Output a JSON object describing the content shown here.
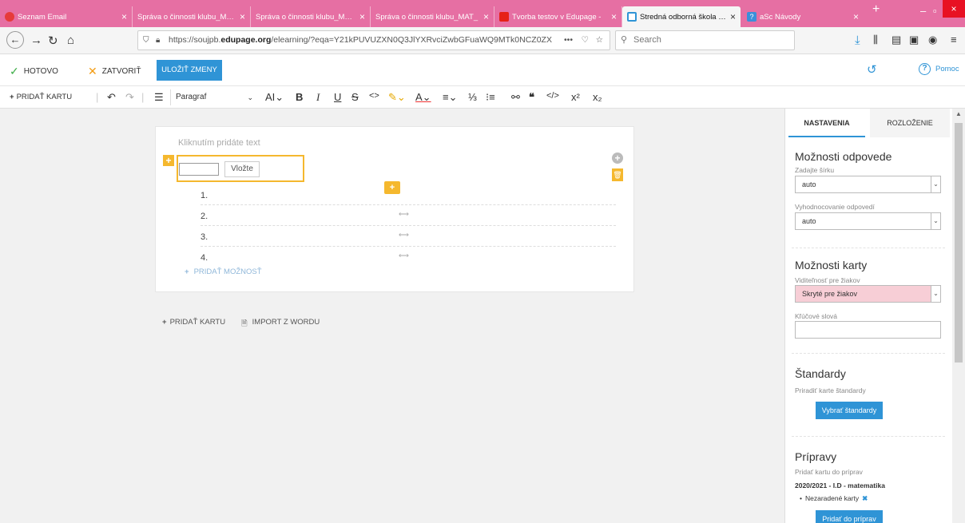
{
  "browser": {
    "tabs": [
      {
        "label": "Seznam Email",
        "icon": "seznam-icon",
        "active": false
      },
      {
        "label": "Správa o činnosti klubu_MAT_",
        "icon": "",
        "active": false
      },
      {
        "label": "Správa o činnosti klubu_MAT_",
        "icon": "",
        "active": false
      },
      {
        "label": "Správa o činnosti klubu_MAT_",
        "icon": "",
        "active": false
      },
      {
        "label": "Tvorba testov v Edupage -",
        "icon": "youtube-icon",
        "active": false
      },
      {
        "label": "Stredná odborná škola stro",
        "icon": "edupage-icon",
        "active": true
      },
      {
        "label": "aSc Návody",
        "icon": "help-icon",
        "active": false
      }
    ],
    "url_prefix": "https://soujpb.",
    "url_domain": "edupage.org",
    "url_rest": "/elearning/?eqa=Y21kPUVUZXN0Q3JlYXRvciZwbGFuaWQ9MTk0NCZ0ZX",
    "search_placeholder": "Search"
  },
  "app_toolbar": {
    "done_label": "HOTOVO",
    "close_label": "ZATVORIŤ",
    "save_label": "ULOŽIŤ ZMENY",
    "help_label": "Pomoc"
  },
  "format_toolbar": {
    "add_card_label": "PRIDAŤ KARTU",
    "paragraph_select": "Paragraf"
  },
  "card": {
    "placeholder_text": "Kliknutím pridáte text",
    "insert_button": "Vložte",
    "options": [
      "1.",
      "2.",
      "3.",
      "4."
    ],
    "add_option_label": "PRIDAŤ MOŽNOSŤ"
  },
  "editor_actions": {
    "add_card_label": "PRIDAŤ KARTU",
    "import_label": "IMPORT Z WORDU"
  },
  "panel": {
    "tab_settings": "NASTAVENIA",
    "tab_layout": "ROZLOŽENIE",
    "answer_options_title": "Možnosti odpovede",
    "width_label": "Zadajte šírku",
    "width_value": "auto",
    "eval_label": "Vyhodnocovanie odpovedí",
    "eval_value": "auto",
    "card_options_title": "Možnosti karty",
    "visibility_label": "Viditeľnosť pre žiakov",
    "visibility_value": "Skryté pre žiakov",
    "keywords_label": "Kľúčové slová",
    "standards_title": "Štandardy",
    "standards_desc": "Priradiť karte štandardy",
    "standards_button": "Vybrať štandardy",
    "prep_title": "Prípravy",
    "prep_desc": "Pridať kartu do príprav",
    "prep_year": "2020/2021 - I.D - matematika",
    "prep_item": "Nezaradené karty",
    "prep_button": "Pridať do príprav"
  },
  "colors": {
    "tabbar": "#e66fa3",
    "accent": "#2f94d6",
    "highlight_border": "#f5b82e",
    "hidden_bg": "#f7ced6"
  }
}
